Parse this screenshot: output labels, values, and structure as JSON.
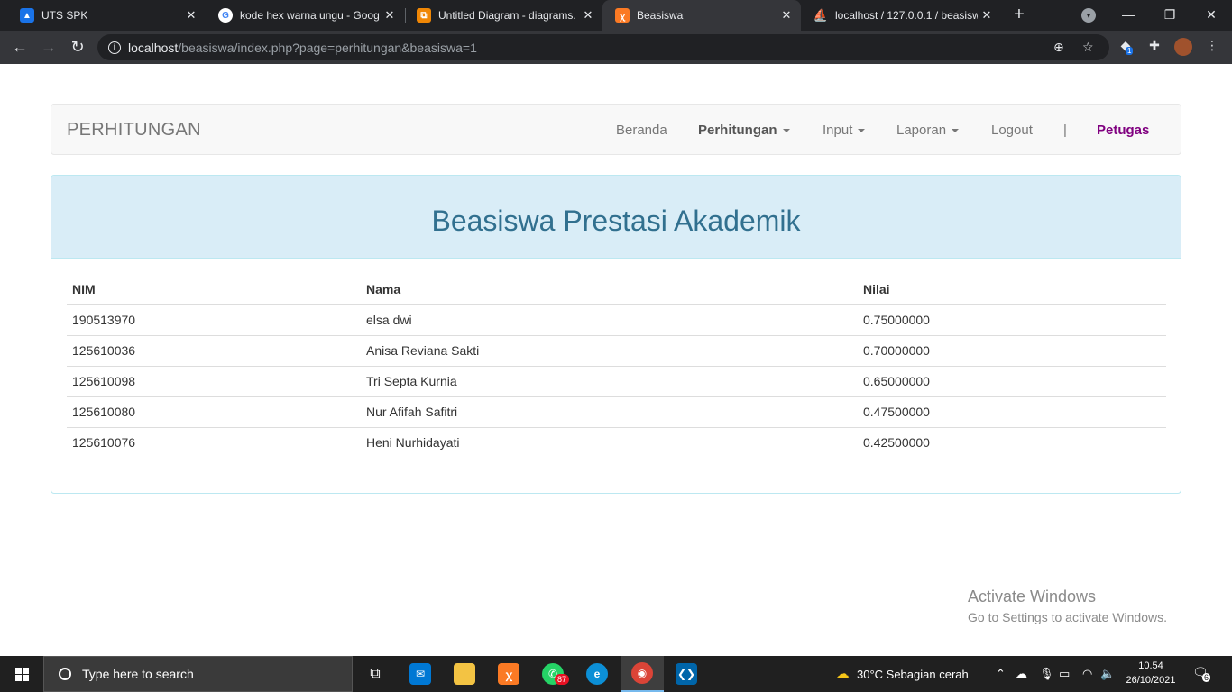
{
  "browser": {
    "tabs": [
      {
        "title": "UTS SPK",
        "icon": "classroom-icon",
        "color": "#1a73e8"
      },
      {
        "title": "kode hex warna ungu - Goog",
        "icon": "google-icon",
        "color": "#ffffff"
      },
      {
        "title": "Untitled Diagram - diagrams.",
        "icon": "drawio-icon",
        "color": "#f08705"
      },
      {
        "title": "Beasiswa",
        "icon": "xampp-icon",
        "color": "#fb7a24",
        "active": true
      },
      {
        "title": "localhost / 127.0.0.1 / beasisw",
        "icon": "phpmyadmin-icon",
        "color": "#f89c0e"
      }
    ],
    "url_host": "localhost",
    "url_path": "/beasiswa/index.php?page=perhitungan&beasiswa=1",
    "extension_badge": "1"
  },
  "navbar": {
    "brand": "PERHITUNGAN",
    "items": [
      "Beranda",
      "Perhitungan",
      "Input",
      "Laporan",
      "Logout",
      "|",
      "Petugas"
    ],
    "accent_color": "#800080"
  },
  "panel": {
    "title": "Beasiswa Prestasi Akademik",
    "heading_bg": "#d9edf7",
    "title_color": "#31708f"
  },
  "table": {
    "headers": [
      "NIM",
      "Nama",
      "Nilai"
    ],
    "rows": [
      [
        "190513970",
        "elsa dwi",
        "0.75000000"
      ],
      [
        "125610036",
        "Anisa Reviana Sakti",
        "0.70000000"
      ],
      [
        "125610098",
        "Tri Septa Kurnia",
        "0.65000000"
      ],
      [
        "125610080",
        "Nur Afifah Safitri",
        "0.47500000"
      ],
      [
        "125610076",
        "Heni Nurhidayati",
        "0.42500000"
      ]
    ]
  },
  "watermark": {
    "line1": "Activate Windows",
    "line2": "Go to Settings to activate Windows."
  },
  "taskbar": {
    "search_placeholder": "Type here to search",
    "whatsapp_badge": "87",
    "weather": "30°C  Sebagian cerah",
    "time": "10.54",
    "date": "26/10/2021",
    "notification_count": "6"
  }
}
